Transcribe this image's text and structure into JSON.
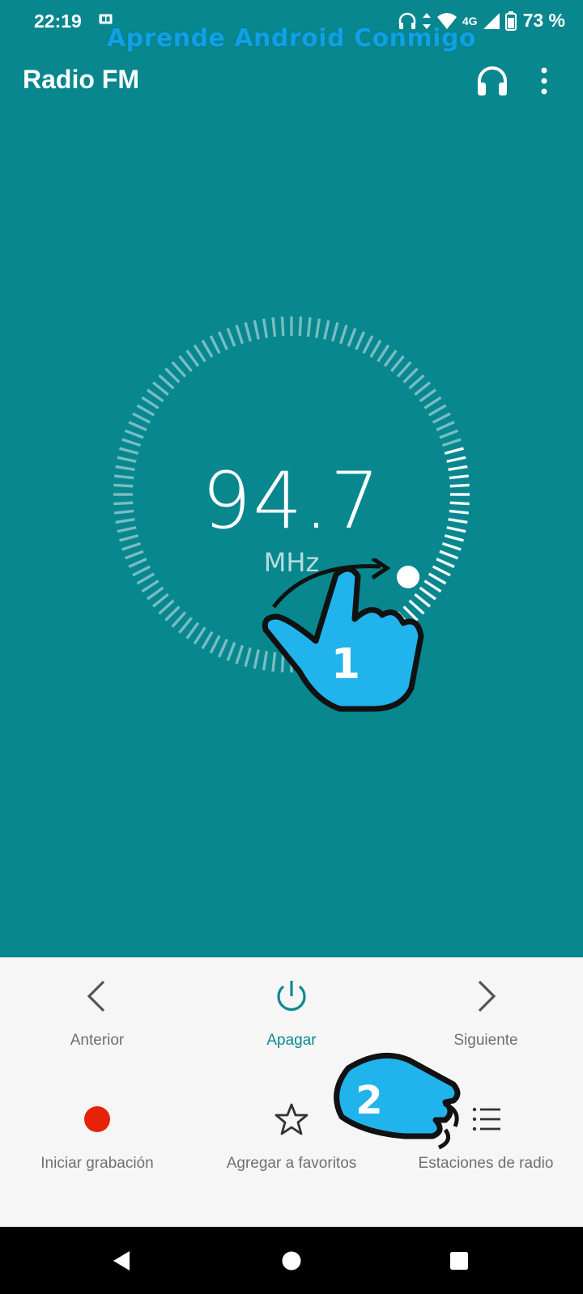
{
  "status": {
    "time": "22:19",
    "network": "4G",
    "battery": "73 %"
  },
  "watermark": "Aprende Android Conmigo",
  "app": {
    "title": "Radio FM"
  },
  "tuner": {
    "frequency": "94.7",
    "unit": "MHz"
  },
  "annotations": {
    "step1": "1",
    "step2": "2"
  },
  "controls": {
    "previous": "Anterior",
    "power": "Apagar",
    "next": "Siguiente",
    "record": "Iniciar grabación",
    "favorite": "Agregar a favoritos",
    "stations": "Estaciones de radio"
  },
  "colors": {
    "background": "#08878f",
    "accent": "#0a8a93",
    "record": "#e8210b",
    "panel": "#f6f6f6",
    "annotation": "#21b4ec"
  }
}
